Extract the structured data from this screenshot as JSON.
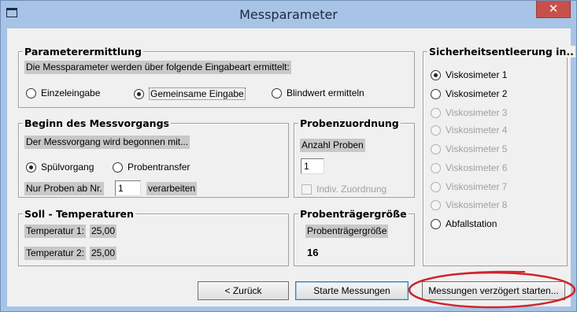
{
  "window": {
    "title": "Messparameter",
    "close_glyph": "✕"
  },
  "parameterermittlung": {
    "legend": "Parameterermittlung",
    "description": "Die Messparameter werden über folgende Eingabeart ermittelt:",
    "options": [
      {
        "label": "Einzeleingabe",
        "selected": false
      },
      {
        "label": "Gemeinsame Eingabe",
        "selected": true
      },
      {
        "label": "Blindwert ermitteln",
        "selected": false
      }
    ]
  },
  "beginn": {
    "legend": "Beginn des Messvorgangs",
    "description": "Der Messvorgang wird begonnen mit...",
    "options": [
      {
        "label": "Spülvorgang",
        "selected": true
      },
      {
        "label": "Probentransfer",
        "selected": false
      }
    ],
    "nur_proben_label": "Nur Proben ab Nr.",
    "nur_proben_value": "1",
    "verarbeiten_label": "verarbeiten"
  },
  "probenzuordnung": {
    "legend": "Probenzuordnung",
    "anzahl_label": "Anzahl Proben",
    "anzahl_value": "1",
    "indiv_label": "Indiv. Zuordnung"
  },
  "soll_temperaturen": {
    "legend": "Soll - Temperaturen",
    "rows": [
      {
        "label": "Temperatur 1:",
        "value": "25,00"
      },
      {
        "label": "Temperatur 2:",
        "value": "25,00"
      }
    ]
  },
  "probentraegergroesse": {
    "legend": "Probenträgergröße",
    "label": "Probenträgergröße",
    "value": "16"
  },
  "sicherheitsentleerung": {
    "legend": "Sicherheitsentleerung in..",
    "options": [
      {
        "label": "Viskosimeter 1",
        "selected": true,
        "enabled": true
      },
      {
        "label": "Viskosimeter 2",
        "selected": false,
        "enabled": true
      },
      {
        "label": "Viskosimeter 3",
        "selected": false,
        "enabled": false
      },
      {
        "label": "Viskosimeter 4",
        "selected": false,
        "enabled": false
      },
      {
        "label": "Viskosimeter 5",
        "selected": false,
        "enabled": false
      },
      {
        "label": "Viskosimeter 6",
        "selected": false,
        "enabled": false
      },
      {
        "label": "Viskosimeter 7",
        "selected": false,
        "enabled": false
      },
      {
        "label": "Viskosimeter 8",
        "selected": false,
        "enabled": false
      },
      {
        "label": "Abfallstation",
        "selected": false,
        "enabled": true
      }
    ]
  },
  "buttons": {
    "back": "< Zurück",
    "start": "Starte Messungen",
    "delayed": "Messungen verzögert starten..."
  },
  "colors": {
    "titlebar": "#a7c3e6",
    "close_button": "#c7504a",
    "highlight_annotation": "#d0252a"
  }
}
